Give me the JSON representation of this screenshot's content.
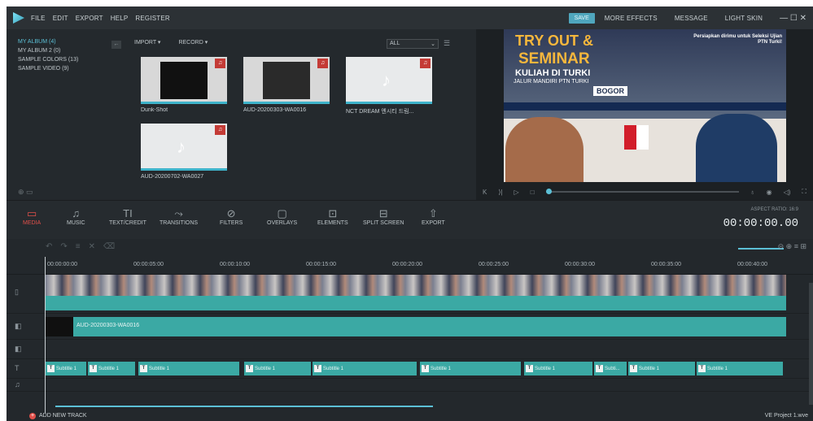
{
  "menubar": {
    "items": [
      "FILE",
      "EDIT",
      "EXPORT",
      "HELP",
      "REGISTER"
    ],
    "save": "SAVE",
    "more_effects": "MORE EFFECTS",
    "message": "MESSAGE",
    "skin": "LIGHT SKIN",
    "controls": "— ☐ ✕"
  },
  "library": {
    "albums": [
      "MY ALBUM (4)",
      "MY ALBUM 2 (0)",
      "SAMPLE COLORS (13)",
      "SAMPLE VIDEO (9)"
    ],
    "import": "IMPORT ▾",
    "record": "RECORD ▾",
    "filter": "ALL",
    "clips": [
      "Dunk-Shot",
      "AUD-20200303-WA0016",
      "NCT DREAM 엔시티 드림...",
      "AUD-20200702-WA0027"
    ]
  },
  "preview": {
    "title1": "TRY OUT &",
    "title2": "SEMINAR",
    "title3": "KULIAH DI TURKI",
    "title4": "JALUR MANDIRI PTN TURKI",
    "title5": "BOGOR",
    "side": "Persiapkan dirimu untuk Seleksi Ujian PTN Turki!"
  },
  "toolbar": {
    "tools": [
      "MEDIA",
      "MUSIC",
      "TEXT/CREDIT",
      "TRANSITIONS",
      "FILTERS",
      "OVERLAYS",
      "ELEMENTS",
      "SPLIT SCREEN",
      "EXPORT"
    ],
    "aspect": "ASPECT RATIO: 16:9",
    "timecode": "00:00:00.00"
  },
  "ruler": [
    "00:00:00:00",
    "00:00:05:00",
    "00:00:10:00",
    "00:00:15:00",
    "00:00:20:00",
    "00:00:25:00",
    "00:00:30:00",
    "00:00:35:00",
    "00:00:40:00"
  ],
  "timeline": {
    "audio_label": "AUD-20200303-WA0016",
    "subtitles": [
      "Subtitle 1",
      "Subtitle 1",
      "Subtitle 1",
      "Subtitle 1",
      "Subtitle 1",
      "Subtitle 1",
      "Subtitle 1",
      "Subti...",
      "Subtitle 1",
      "Subtitle 1"
    ]
  },
  "footer": {
    "add_track": "ADD NEW TRACK",
    "project": "VE Project 1.wve"
  },
  "colors": {
    "accent": "#5cc0d6",
    "track": "#3ba9a4",
    "active": "#e0504a"
  }
}
